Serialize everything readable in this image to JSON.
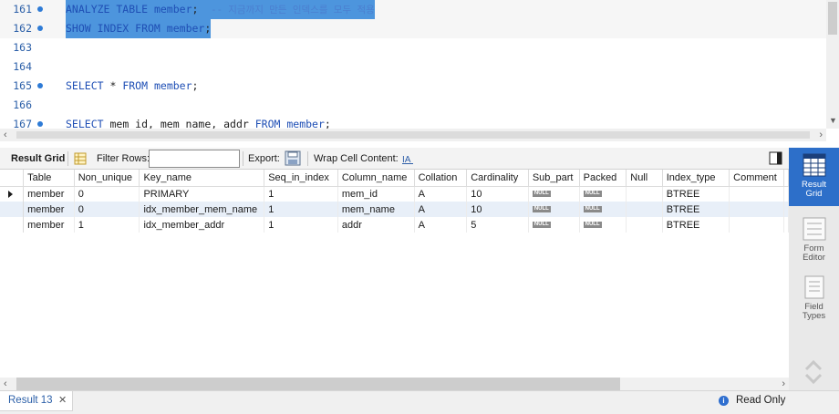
{
  "editor": {
    "lines": [
      {
        "num": "161",
        "dot": true,
        "selected": true,
        "parts": [
          [
            "kw",
            "ANALYZE TABLE"
          ],
          [
            "sp",
            " "
          ],
          [
            "ident",
            "member"
          ],
          [
            "tx",
            ";  "
          ],
          [
            "cm",
            "-- 지금까지 만든 인덱스를 모두 적용"
          ]
        ]
      },
      {
        "num": "162",
        "dot": true,
        "selected": true,
        "parts": [
          [
            "kw",
            "SHOW INDEX FROM"
          ],
          [
            "sp",
            " "
          ],
          [
            "ident",
            "member"
          ],
          [
            "tx",
            ";"
          ]
        ]
      },
      {
        "num": "163",
        "dot": false,
        "selected": false,
        "parts": []
      },
      {
        "num": "164",
        "dot": false,
        "selected": false,
        "parts": []
      },
      {
        "num": "165",
        "dot": true,
        "selected": false,
        "parts": [
          [
            "kw",
            "SELECT"
          ],
          [
            "tx",
            " * "
          ],
          [
            "kw",
            "FROM"
          ],
          [
            "sp",
            " "
          ],
          [
            "ident",
            "member"
          ],
          [
            "tx",
            ";"
          ]
        ]
      },
      {
        "num": "166",
        "dot": false,
        "selected": false,
        "parts": []
      },
      {
        "num": "167",
        "dot": true,
        "selected": false,
        "parts": [
          [
            "kw",
            "SELECT"
          ],
          [
            "tx",
            " mem_id, mem_name, addr "
          ],
          [
            "kw",
            "FROM"
          ],
          [
            "sp",
            " "
          ],
          [
            "ident",
            "member"
          ],
          [
            "tx",
            ";"
          ]
        ]
      }
    ]
  },
  "toolbar": {
    "result_grid_label": "Result Grid",
    "filter_label": "Filter Rows:",
    "filter_value": "",
    "export_label": "Export:",
    "wrap_label": "Wrap Cell Content:"
  },
  "grid": {
    "columns": [
      "Table",
      "Non_unique",
      "Key_name",
      "Seq_in_index",
      "Column_name",
      "Collation",
      "Cardinality",
      "Sub_part",
      "Packed",
      "Null",
      "Index_type",
      "Comment"
    ],
    "null_label": "NULL",
    "rows": [
      [
        "member",
        "0",
        "PRIMARY",
        "1",
        "mem_id",
        "A",
        "10",
        "NULL",
        "NULL",
        "",
        "BTREE",
        ""
      ],
      [
        "member",
        "0",
        "idx_member_mem_name",
        "1",
        "mem_name",
        "A",
        "10",
        "NULL",
        "NULL",
        "",
        "BTREE",
        ""
      ],
      [
        "member",
        "1",
        "idx_member_addr",
        "1",
        "addr",
        "A",
        "5",
        "NULL",
        "NULL",
        "",
        "BTREE",
        ""
      ]
    ]
  },
  "side_panel": {
    "result_grid": "Result Grid",
    "form_editor": "Form Editor",
    "field_types": "Field Types"
  },
  "bottom": {
    "tab_label": "Result 13",
    "tab_close": "✕",
    "info": "i",
    "status": "Read Only"
  }
}
